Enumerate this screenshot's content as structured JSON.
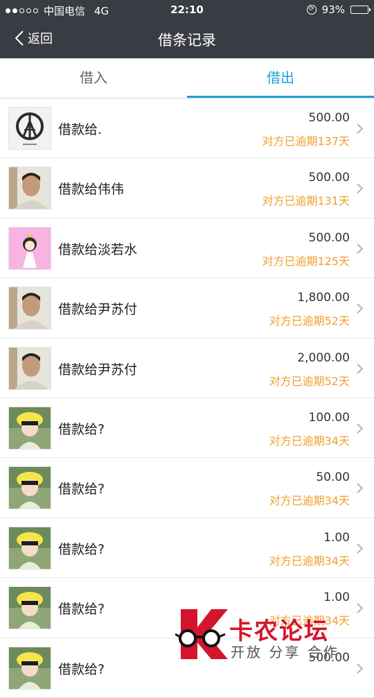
{
  "status_bar": {
    "carrier": "中国电信",
    "network": "4G",
    "time": "22:10",
    "battery": "93%",
    "battery_level": 0.93
  },
  "nav": {
    "back_label": "返回",
    "title": "借条记录"
  },
  "tabs": [
    {
      "label": "借入",
      "selected": false
    },
    {
      "label": "借出",
      "selected": true
    }
  ],
  "records": [
    {
      "title": "借款给.",
      "amount": "500.00",
      "status": "对方已逾期137天",
      "avatar": "peace-eiffel-icon"
    },
    {
      "title": "借款给伟伟",
      "amount": "500.00",
      "status": "对方已逾期131天",
      "avatar": "user-photo"
    },
    {
      "title": "借款给淡若水",
      "amount": "500.00",
      "status": "对方已逾期125天",
      "avatar": "cartoon-princess-icon"
    },
    {
      "title": "借款给尹苏付",
      "amount": "1,800.00",
      "status": "对方已逾期52天",
      "avatar": "user-photo"
    },
    {
      "title": "借款给尹苏付",
      "amount": "2,000.00",
      "status": "对方已逾期52天",
      "avatar": "user-photo"
    },
    {
      "title": "借款给?",
      "amount": "100.00",
      "status": "对方已逾期34天",
      "avatar": "child-photo"
    },
    {
      "title": "借款给?",
      "amount": "50.00",
      "status": "对方已逾期34天",
      "avatar": "child-photo"
    },
    {
      "title": "借款给?",
      "amount": "1.00",
      "status": "对方已逾期34天",
      "avatar": "child-photo"
    },
    {
      "title": "借款给?",
      "amount": "1.00",
      "status": "对方已逾期34天",
      "avatar": "child-photo"
    },
    {
      "title": "借款给?",
      "amount": "500.00",
      "status": "",
      "avatar": "child-photo"
    }
  ],
  "watermark": {
    "name": "卡农论坛",
    "slogan": "开放 分享 合作"
  },
  "colors": {
    "header_bg": "#3a3c43",
    "accent": "#1e9fdc",
    "overdue": "#f0a030",
    "brand_red": "#d4152b"
  }
}
